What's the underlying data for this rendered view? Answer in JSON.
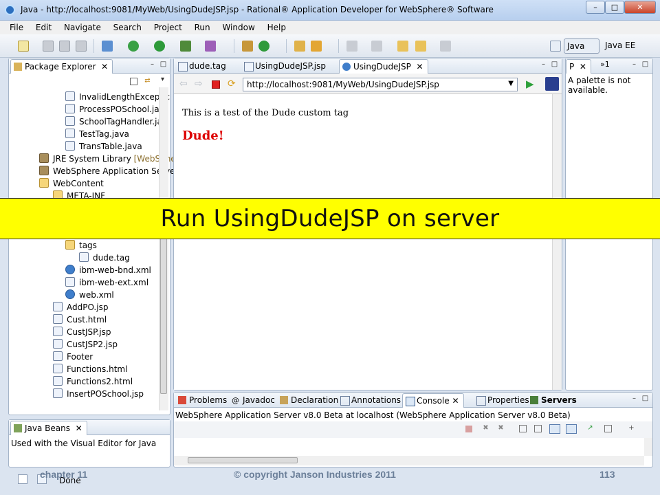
{
  "window": {
    "title": "Java - http://localhost:9081/MyWeb/UsingDudeJSP.jsp - Rational® Application Developer for WebSphere® Software"
  },
  "menu": [
    "File",
    "Edit",
    "Navigate",
    "Search",
    "Project",
    "Run",
    "Window",
    "Help"
  ],
  "perspectives": {
    "java": "Java",
    "java_ee": "Java EE"
  },
  "package_explorer": {
    "title": "Package Explorer",
    "items": [
      {
        "label": "InvalidLengthExceptic",
        "icon": "java-file-icon"
      },
      {
        "label": "ProcessPOSchool.java",
        "icon": "java-file-icon"
      },
      {
        "label": "SchoolTagHandler.jav",
        "icon": "java-file-icon"
      },
      {
        "label": "TestTag.java",
        "icon": "java-file-icon"
      },
      {
        "label": "TransTable.java",
        "icon": "java-file-icon"
      },
      {
        "label": "JRE System Library",
        "decor": "[WebSphe",
        "icon": "library-icon"
      },
      {
        "label": "WebSphere Application Serve",
        "icon": "library-icon"
      },
      {
        "label": "WebContent",
        "icon": "folder-icon"
      },
      {
        "label": "META-INF",
        "icon": "folder-icon"
      },
      {
        "label": "tags",
        "icon": "folder-icon"
      },
      {
        "label": "dude.tag",
        "icon": "file-icon"
      },
      {
        "label": "ibm-web-bnd.xml",
        "icon": "xml-icon"
      },
      {
        "label": "ibm-web-ext.xml",
        "icon": "xml-icon"
      },
      {
        "label": "web.xml",
        "icon": "xml-icon"
      },
      {
        "label": "AddPO.jsp",
        "icon": "jsp-icon"
      },
      {
        "label": "Cust.html",
        "icon": "html-icon"
      },
      {
        "label": "CustJSP.jsp",
        "icon": "jsp-icon"
      },
      {
        "label": "CustJSP2.jsp",
        "icon": "jsp-icon"
      },
      {
        "label": "Footer",
        "icon": "file-icon"
      },
      {
        "label": "Functions.html",
        "icon": "html-icon"
      },
      {
        "label": "Functions2.html",
        "icon": "html-icon"
      },
      {
        "label": "InsertPOSchool.jsp",
        "icon": "jsp-icon"
      }
    ]
  },
  "java_beans": {
    "title": "Java Beans",
    "text": "Used with the Visual Editor for Java"
  },
  "editor": {
    "tabs": [
      "dude.tag",
      "UsingDudeJSP.jsp",
      "UsingDudeJSP"
    ],
    "url": "http://localhost:9081/MyWeb/UsingDudeJSP.jsp",
    "page_text": "This is a test of the Dude custom tag",
    "page_heading": "Dude!"
  },
  "palette": {
    "tab": "P",
    "overflow": "1",
    "text": "A palette is not available."
  },
  "console": {
    "tabs": [
      "Problems",
      "Javadoc",
      "Declaration",
      "Annotations",
      "Console",
      "Properties",
      "Servers"
    ],
    "server_line": "WebSphere Application Server v8.0 Beta at localhost (WebSphere Application Server v8.0 Beta)"
  },
  "banner": "Run UsingDudeJSP on server",
  "status": "Done",
  "footer": {
    "chapter": "chapter 11",
    "copyright": "© copyright Janson Industries 2011",
    "page": "113"
  }
}
